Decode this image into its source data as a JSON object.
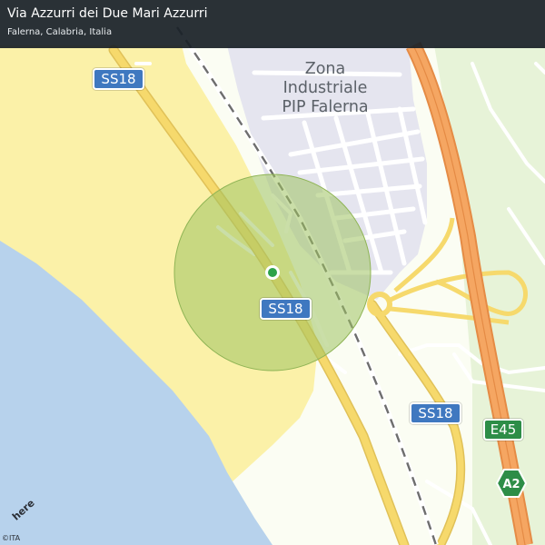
{
  "header": {
    "title": "Via Azzurri dei Due Mari Azzurri",
    "subtitle": "Falerna, Calabria, Italia"
  },
  "map": {
    "area_label_lines": [
      "Zona",
      "Industriale",
      "PIP Falerna"
    ],
    "road_labels": {
      "ss18_top": "SS18",
      "ss18_center": "SS18",
      "ss18_right": "SS18",
      "e45": "E45",
      "a2": "A2"
    },
    "brand": "here",
    "copyright": "©ITA",
    "marker_icon": "location-dot-icon",
    "colors": {
      "sea": "#b7d2ec",
      "beach": "#fbf1a8",
      "land": "#fbfdf3",
      "green": "#e7f3d8",
      "industrial": "#e5e5ef",
      "main_road": "#f6d96c",
      "highway": "#f5a662",
      "railway": "#6e6e6e",
      "accuracy_circle": "#9ec360",
      "marker": "#2ea24a",
      "shield_blue": "#3f78c0",
      "shield_green": "#2d8d47"
    }
  }
}
